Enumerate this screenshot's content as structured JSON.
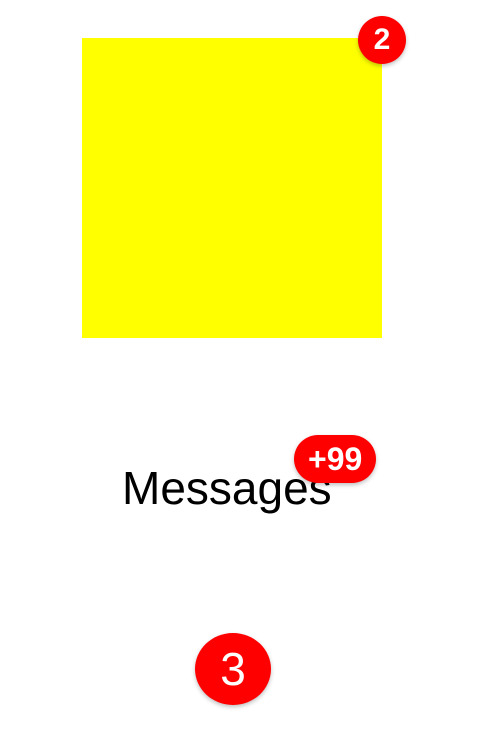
{
  "square_card": {
    "color": "#ffff00",
    "badge": "2"
  },
  "messages": {
    "label": "Messages",
    "badge": "+99"
  },
  "standalone_badge": {
    "value": "3"
  },
  "colors": {
    "badge_bg": "#ff0000",
    "badge_text": "#ffffff"
  }
}
